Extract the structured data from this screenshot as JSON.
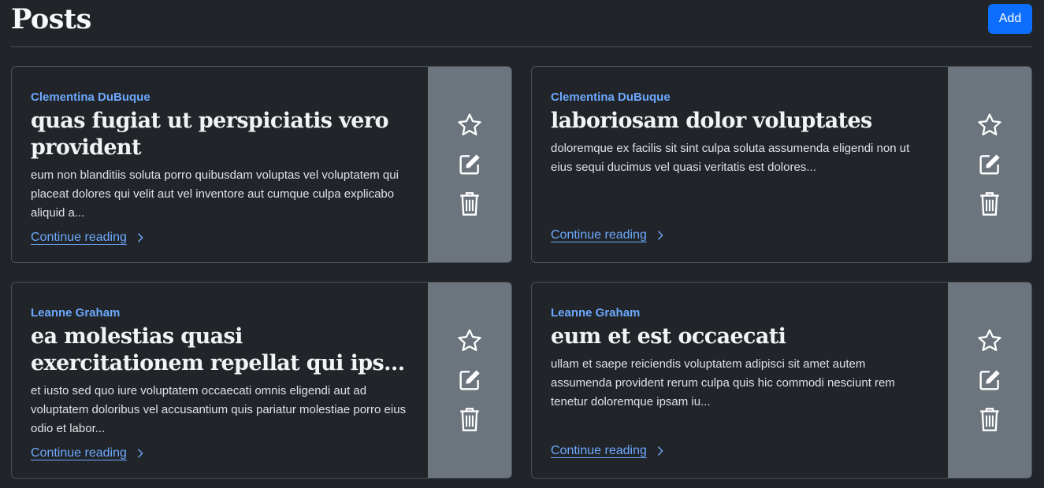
{
  "header": {
    "title": "Posts",
    "add_label": "Add"
  },
  "colors": {
    "background": "#212529",
    "accent": "#0d6efd",
    "link": "#6ea8fe",
    "action_panel": "#6c757d"
  },
  "posts": [
    {
      "author": "Clementina DuBuque",
      "title": "quas fugiat ut perspiciatis vero provident",
      "excerpt": "eum non blanditiis soluta porro quibusdam voluptas vel voluptatem qui placeat dolores qui velit aut vel inventore aut cumque culpa explicabo aliquid a...",
      "link_label": "Continue reading"
    },
    {
      "author": "Clementina DuBuque",
      "title": "laboriosam dolor voluptates",
      "excerpt": "doloremque ex facilis sit sint culpa soluta assumenda eligendi non ut eius sequi ducimus vel quasi veritatis est dolores...",
      "link_label": "Continue reading"
    },
    {
      "author": "Leanne Graham",
      "title": "ea molestias quasi exercitationem repellat qui ips...",
      "excerpt": "et iusto sed quo iure voluptatem occaecati omnis eligendi aut ad voluptatem doloribus vel accusantium quis pariatur molestiae porro eius odio et labor...",
      "link_label": "Continue reading"
    },
    {
      "author": "Leanne Graham",
      "title": "eum et est occaecati",
      "excerpt": "ullam et saepe reiciendis voluptatem adipisci sit amet autem assumenda provident rerum culpa quis hic commodi nesciunt rem tenetur doloremque ipsam iu...",
      "link_label": "Continue reading"
    }
  ],
  "icons": {
    "favorite": "star-icon",
    "edit": "edit-icon",
    "delete": "trash-icon",
    "chevron": "chevron-right-icon"
  }
}
